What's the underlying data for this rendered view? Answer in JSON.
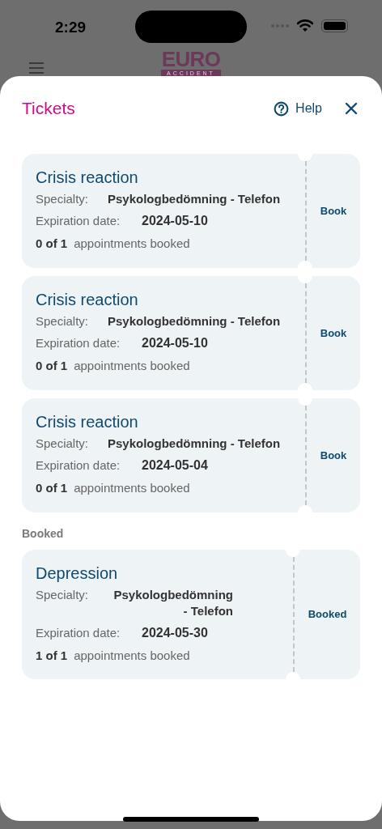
{
  "status_bar": {
    "time": "2:29"
  },
  "background": {
    "logo": "EURO",
    "logo_subtitle": "ACCIDENT"
  },
  "sheet": {
    "title": "Tickets",
    "help": "Help"
  },
  "tickets": [
    {
      "kind": "available",
      "title": "Crisis reaction",
      "specialty_label": "Specialty:",
      "specialty": "Psykologbedömning - Telefon",
      "expiration_label": "Expiration date:",
      "expiration": "2024-05-10",
      "count": "0 of 1",
      "count_label": "appointments booked",
      "action": "Book"
    },
    {
      "kind": "available",
      "title": "Crisis reaction",
      "specialty_label": "Specialty:",
      "specialty": "Psykologbedömning - Telefon",
      "expiration_label": "Expiration date:",
      "expiration": "2024-05-10",
      "count": "0 of 1",
      "count_label": "appointments booked",
      "action": "Book"
    },
    {
      "kind": "available",
      "title": "Crisis reaction",
      "specialty_label": "Specialty:",
      "specialty": "Psykologbedömning - Telefon",
      "expiration_label": "Expiration date:",
      "expiration": "2024-05-04",
      "count": "0 of 1",
      "count_label": "appointments booked",
      "action": "Book"
    }
  ],
  "booked_section": {
    "heading": "Booked",
    "tickets": [
      {
        "kind": "booked",
        "title": "Depression",
        "specialty_label": "Specialty:",
        "specialty": "Psykologbedömning - Telefon",
        "expiration_label": "Expiration date:",
        "expiration": "2024-05-30",
        "count": "1 of 1",
        "count_label": "appointments booked",
        "action": "Booked"
      }
    ]
  }
}
